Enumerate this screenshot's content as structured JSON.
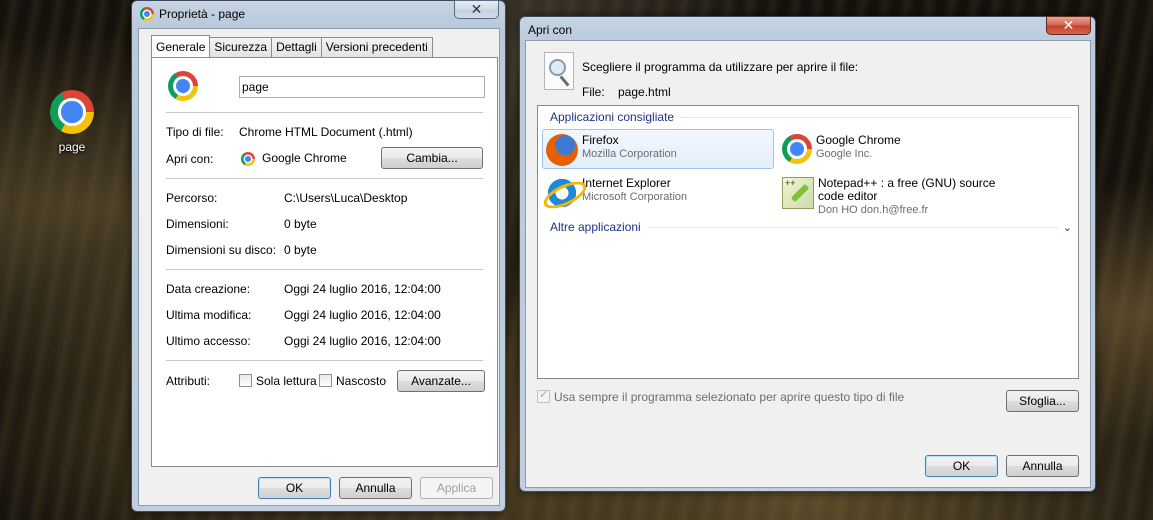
{
  "desktop": {
    "icon_label": "page"
  },
  "properties": {
    "title": "Proprietà - page",
    "tabs": [
      "Generale",
      "Sicurezza",
      "Dettagli",
      "Versioni precedenti"
    ],
    "file_name": "page",
    "rows": {
      "file_type_label": "Tipo di file:",
      "file_type_value": "Chrome HTML Document (.html)",
      "opens_with_label": "Apri con:",
      "opens_with_value": "Google Chrome",
      "change_button": "Cambia...",
      "location_label": "Percorso:",
      "location_value": "C:\\Users\\Luca\\Desktop",
      "size_label": "Dimensioni:",
      "size_value": "0 byte",
      "size_on_disk_label": "Dimensioni su disco:",
      "size_on_disk_value": "0 byte",
      "created_label": "Data creazione:",
      "created_value": "Oggi 24 luglio 2016, 12:04:00",
      "modified_label": "Ultima modifica:",
      "modified_value": "Oggi 24 luglio 2016, 12:04:00",
      "accessed_label": "Ultimo accesso:",
      "accessed_value": "Oggi 24 luglio 2016, 12:04:00",
      "attributes_label": "Attributi:",
      "readonly_label": "Sola lettura",
      "hidden_label": "Nascosto",
      "advanced_button": "Avanzate..."
    },
    "buttons": {
      "ok": "OK",
      "cancel": "Annulla",
      "apply": "Applica"
    }
  },
  "open_with": {
    "title": "Apri con",
    "instruction": "Scegliere il programma da utilizzare per aprire il file:",
    "file_label": "File:",
    "file_value": "page.html",
    "recommended_header": "Applicazioni consigliate",
    "other_header": "Altre applicazioni",
    "apps": [
      {
        "name": "Firefox",
        "publisher": "Mozilla Corporation",
        "icon": "firefox-icon",
        "selected": true
      },
      {
        "name": "Google Chrome",
        "publisher": "Google Inc.",
        "icon": "chrome-icon",
        "selected": false
      },
      {
        "name": "Internet Explorer",
        "publisher": "Microsoft Corporation",
        "icon": "internet-explorer-icon",
        "selected": false
      },
      {
        "name": "Notepad++ : a free (GNU) source code editor",
        "publisher": "Don HO don.h@free.fr",
        "icon": "notepad-plus-plus-icon",
        "selected": false
      }
    ],
    "always_use_label": "Usa sempre il programma selezionato per aprire questo tipo di file",
    "always_use_checked": true,
    "browse_button": "Sfoglia...",
    "buttons": {
      "ok": "OK",
      "cancel": "Annulla"
    }
  }
}
